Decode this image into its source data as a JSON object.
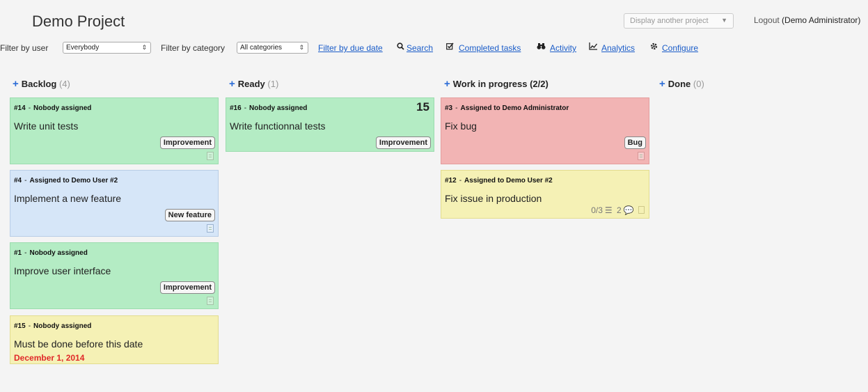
{
  "header": {
    "project_title": "Demo Project",
    "project_select": "Display another project",
    "logout": "Logout",
    "logged_user": "(Demo Administrator)"
  },
  "filters": {
    "user_label": "Filter by user",
    "user_value": "Everybody",
    "category_label": "Filter by category",
    "category_value": "All categories",
    "due_date": "Filter by due date",
    "search": "Search",
    "completed": "Completed tasks",
    "activity": "Activity",
    "analytics": "Analytics",
    "configure": "Configure"
  },
  "columns": [
    {
      "title": "Backlog",
      "count": "(4)"
    },
    {
      "title": "Ready",
      "count": "(1)"
    },
    {
      "title": "Work in progress",
      "count": "(2/2)"
    },
    {
      "title": "Done",
      "count": "(0)"
    }
  ],
  "cards": {
    "c14": {
      "id": "#14",
      "assignee": "Nobody assigned",
      "title": "Write unit tests",
      "category": "Improvement"
    },
    "c4": {
      "id": "#4",
      "assignee": "Assigned to Demo User #2",
      "title": "Implement a new feature",
      "category": "New feature"
    },
    "c1": {
      "id": "#1",
      "assignee": "Nobody assigned",
      "title": "Improve user interface",
      "category": "Improvement"
    },
    "c15": {
      "id": "#15",
      "assignee": "Nobody assigned",
      "title": "Must be done before this date",
      "due": "December 1, 2014"
    },
    "c16": {
      "id": "#16",
      "assignee": "Nobody assigned",
      "title": "Write functionnal tests",
      "category": "Improvement",
      "points": "15"
    },
    "c3": {
      "id": "#3",
      "assignee": "Assigned to Demo Administrator",
      "title": "Fix bug",
      "category": "Bug"
    },
    "c12": {
      "id": "#12",
      "assignee": "Assigned to Demo User #2",
      "title": "Fix issue in production",
      "subtasks": "0/3",
      "comments": "2"
    }
  },
  "colors": {
    "green": "#b4ecc4",
    "blue": "#d6e6f8",
    "red": "#f2b4b4",
    "yellow": "#f5f1b5",
    "link": "#1a5cc8",
    "accent": "#2a6bd6",
    "due": "#e02828"
  },
  "icons": [
    "search-icon",
    "checkbox-icon",
    "binoculars-icon",
    "chart-icon",
    "gear-icon",
    "plus-icon",
    "document-icon",
    "list-icon",
    "comment-icon",
    "caret-down-icon"
  ]
}
